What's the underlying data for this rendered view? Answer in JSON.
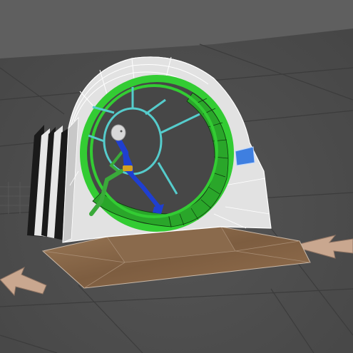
{
  "viewport": {
    "background_color": "#4a4a4a",
    "backdrop_color": "#5e5e5e",
    "grid_color": "#3e3e3e"
  },
  "scene": {
    "objects": [
      {
        "name": "hamster-wheel-housing",
        "color": "#e2e2e2",
        "wire_color": "#ffffff"
      },
      {
        "name": "running-wheel",
        "color": "#33cc33",
        "wire_color": "#113311"
      },
      {
        "name": "wheel-spokes",
        "color": "#55cccc"
      },
      {
        "name": "wooden-base",
        "color": "#8b6a4a"
      },
      {
        "name": "biped-character",
        "color": "#1f3fd0",
        "secondary_color": "#3aaa3a",
        "head_color": "#d8d8d8"
      },
      {
        "name": "housing-button",
        "color": "#3f7fe0"
      }
    ],
    "arrows": [
      {
        "name": "arrow-left",
        "color": "#c9a78f",
        "direction": "left"
      },
      {
        "name": "arrow-right",
        "color": "#c9a78f",
        "direction": "left"
      }
    ]
  }
}
